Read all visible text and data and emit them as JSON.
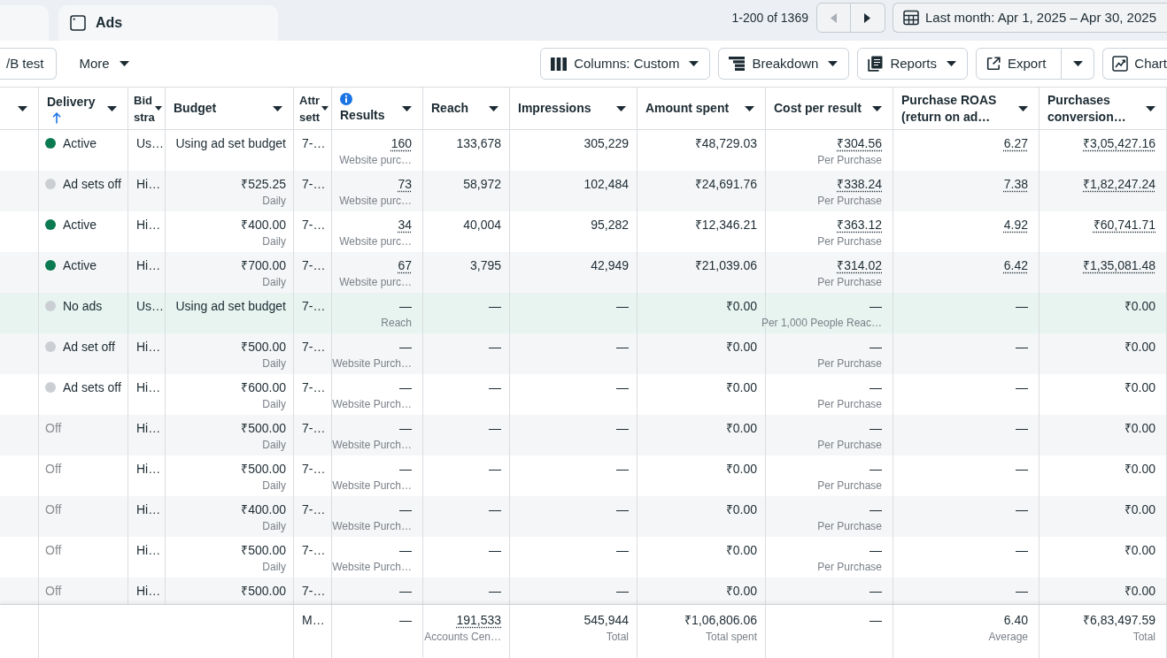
{
  "tabs": [
    {
      "kind": "stub"
    },
    {
      "kind": "tab",
      "label": "Ads"
    }
  ],
  "pagination": {
    "range": "1-200 of 1369",
    "previous": {
      "disabled": true
    },
    "next": {
      "disabled": false
    }
  },
  "date_range": {
    "label": "Last month: Apr 1, 2025 – Apr 30, 2025"
  },
  "toolbar": {
    "left": [
      {
        "kind": "clipped",
        "label": "/B test"
      },
      {
        "kind": "menu",
        "label": "More"
      }
    ],
    "right": [
      {
        "kind": "dropdown",
        "label": "Columns: Custom"
      },
      {
        "kind": "dropdown",
        "label": "Breakdown"
      },
      {
        "kind": "dropdown",
        "label": "Reports"
      },
      {
        "kind": "split",
        "label": "Export"
      },
      {
        "kind": "clipped",
        "label": "Chart"
      }
    ]
  },
  "table": {
    "columns": [
      {
        "sorted": false,
        "info": false
      },
      {
        "label": "Delivery",
        "sorted": true,
        "info": false
      },
      {
        "label": "Bid stra",
        "sorted": false,
        "info": false
      },
      {
        "label": "Budget",
        "sorted": false,
        "info": false
      },
      {
        "label": "Attr sett",
        "sorted": false,
        "info": false
      },
      {
        "label": "Results",
        "sorted": false,
        "info": true
      },
      {
        "label": "Reach",
        "sorted": false,
        "info": false
      },
      {
        "label": "Impressions",
        "sorted": false,
        "info": false
      },
      {
        "label": "Amount spent",
        "sorted": false,
        "info": false
      },
      {
        "label": "Cost per result",
        "sorted": false,
        "info": false
      },
      {
        "label": "Purchase ROAS (return on ad…",
        "sorted": false,
        "info": false
      },
      {
        "label": "Purchases conversion…",
        "sorted": false,
        "info": false
      }
    ],
    "rows": [
      {
        "highlighted": false,
        "cells": [
          "",
          {
            "value": "Active",
            "color": "#0b7a51",
            "muted": false
          },
          {
            "value": "Us…",
            "dotted": false
          },
          {
            "value": "Using ad set budget",
            "dotted": false
          },
          {
            "value": "7-…",
            "dotted": false
          },
          {
            "value": "160",
            "sub": "Website purc…",
            "dotted": true
          },
          {
            "value": "133,678",
            "dotted": false
          },
          {
            "value": "305,229",
            "dotted": false
          },
          {
            "value": "₹48,729.03",
            "dotted": false
          },
          {
            "value": "₹304.56",
            "sub": "Per Purchase",
            "dotted": true
          },
          {
            "value": "6.27",
            "dotted": true
          },
          {
            "value": "₹3,05,427.16",
            "dotted": true
          }
        ]
      },
      {
        "highlighted": false,
        "cells": [
          "",
          {
            "value": "Ad sets off",
            "color": "#cbcfd4",
            "muted": false
          },
          {
            "value": "Hi…",
            "dotted": false
          },
          {
            "value": "₹525.25",
            "sub": "Daily",
            "dotted": false
          },
          {
            "value": "7-…",
            "dotted": false
          },
          {
            "value": "73",
            "sub": "Website purc…",
            "dotted": true
          },
          {
            "value": "58,972",
            "dotted": false
          },
          {
            "value": "102,484",
            "dotted": false
          },
          {
            "value": "₹24,691.76",
            "dotted": false
          },
          {
            "value": "₹338.24",
            "sub": "Per Purchase",
            "dotted": true
          },
          {
            "value": "7.38",
            "dotted": true
          },
          {
            "value": "₹1,82,247.24",
            "dotted": true
          }
        ]
      },
      {
        "highlighted": false,
        "cells": [
          "",
          {
            "value": "Active",
            "color": "#0b7a51",
            "muted": false
          },
          {
            "value": "Hi…",
            "dotted": false
          },
          {
            "value": "₹400.00",
            "sub": "Daily",
            "dotted": false
          },
          {
            "value": "7-…",
            "dotted": false
          },
          {
            "value": "34",
            "sub": "Website purc…",
            "dotted": true
          },
          {
            "value": "40,004",
            "dotted": false
          },
          {
            "value": "95,282",
            "dotted": false
          },
          {
            "value": "₹12,346.21",
            "dotted": false
          },
          {
            "value": "₹363.12",
            "sub": "Per Purchase",
            "dotted": true
          },
          {
            "value": "4.92",
            "dotted": true
          },
          {
            "value": "₹60,741.71",
            "dotted": true
          }
        ]
      },
      {
        "highlighted": false,
        "cells": [
          "",
          {
            "value": "Active",
            "color": "#0b7a51",
            "muted": false
          },
          {
            "value": "Hi…",
            "dotted": false
          },
          {
            "value": "₹700.00",
            "sub": "Daily",
            "dotted": false
          },
          {
            "value": "7-…",
            "dotted": false
          },
          {
            "value": "67",
            "sub": "Website purc…",
            "dotted": true
          },
          {
            "value": "3,795",
            "dotted": false
          },
          {
            "value": "42,949",
            "dotted": false
          },
          {
            "value": "₹21,039.06",
            "dotted": false
          },
          {
            "value": "₹314.02",
            "sub": "Per Purchase",
            "dotted": true
          },
          {
            "value": "6.42",
            "dotted": true
          },
          {
            "value": "₹1,35,081.48",
            "dotted": true
          }
        ]
      },
      {
        "highlighted": true,
        "cells": [
          "",
          {
            "value": "No ads",
            "color": "#cbcfd4",
            "muted": false
          },
          {
            "value": "Us…",
            "dotted": false
          },
          {
            "value": "Using ad set budget",
            "dotted": false
          },
          {
            "value": "7-…",
            "dotted": false
          },
          {
            "value": "—",
            "sub": "Reach",
            "dotted": false
          },
          {
            "value": "—",
            "dotted": false
          },
          {
            "value": "—",
            "dotted": false
          },
          {
            "value": "₹0.00",
            "dotted": false
          },
          {
            "value": "—",
            "sub": "Per 1,000 People Reac…",
            "dotted": false
          },
          {
            "value": "—",
            "dotted": false
          },
          {
            "value": "₹0.00",
            "dotted": false
          }
        ]
      },
      {
        "highlighted": false,
        "cells": [
          "",
          {
            "value": "Ad set off",
            "color": "#cbcfd4",
            "muted": false
          },
          {
            "value": "Hi…",
            "dotted": false
          },
          {
            "value": "₹500.00",
            "sub": "Daily",
            "dotted": false
          },
          {
            "value": "7-…",
            "dotted": false
          },
          {
            "value": "—",
            "sub": "Website Purch…",
            "dotted": false
          },
          {
            "value": "—",
            "dotted": false
          },
          {
            "value": "—",
            "dotted": false
          },
          {
            "value": "₹0.00",
            "dotted": false
          },
          {
            "value": "—",
            "sub": "Per Purchase",
            "dotted": false
          },
          {
            "value": "—",
            "dotted": false
          },
          {
            "value": "₹0.00",
            "dotted": false
          }
        ]
      },
      {
        "highlighted": false,
        "cells": [
          "",
          {
            "value": "Ad sets off",
            "color": "#cbcfd4",
            "muted": false
          },
          {
            "value": "Hi…",
            "dotted": false
          },
          {
            "value": "₹600.00",
            "sub": "Daily",
            "dotted": false
          },
          {
            "value": "7-…",
            "dotted": false
          },
          {
            "value": "—",
            "sub": "Website Purch…",
            "dotted": false
          },
          {
            "value": "—",
            "dotted": false
          },
          {
            "value": "—",
            "dotted": false
          },
          {
            "value": "₹0.00",
            "dotted": false
          },
          {
            "value": "—",
            "sub": "Per Purchase",
            "dotted": false
          },
          {
            "value": "—",
            "dotted": false
          },
          {
            "value": "₹0.00",
            "dotted": false
          }
        ]
      },
      {
        "highlighted": false,
        "cells": [
          "",
          {
            "value": "Off",
            "muted": true
          },
          {
            "value": "Hi…",
            "dotted": false
          },
          {
            "value": "₹500.00",
            "sub": "Daily",
            "dotted": false
          },
          {
            "value": "7-…",
            "dotted": false
          },
          {
            "value": "—",
            "sub": "Website Purch…",
            "dotted": false
          },
          {
            "value": "—",
            "dotted": false
          },
          {
            "value": "—",
            "dotted": false
          },
          {
            "value": "₹0.00",
            "dotted": false
          },
          {
            "value": "—",
            "sub": "Per Purchase",
            "dotted": false
          },
          {
            "value": "—",
            "dotted": false
          },
          {
            "value": "₹0.00",
            "dotted": false
          }
        ]
      },
      {
        "highlighted": false,
        "cells": [
          "",
          {
            "value": "Off",
            "muted": true
          },
          {
            "value": "Hi…",
            "dotted": false
          },
          {
            "value": "₹500.00",
            "sub": "Daily",
            "dotted": false
          },
          {
            "value": "7-…",
            "dotted": false
          },
          {
            "value": "—",
            "sub": "Website Purch…",
            "dotted": false
          },
          {
            "value": "—",
            "dotted": false
          },
          {
            "value": "—",
            "dotted": false
          },
          {
            "value": "₹0.00",
            "dotted": false
          },
          {
            "value": "—",
            "sub": "Per Purchase",
            "dotted": false
          },
          {
            "value": "—",
            "dotted": false
          },
          {
            "value": "₹0.00",
            "dotted": false
          }
        ]
      },
      {
        "highlighted": false,
        "cells": [
          "",
          {
            "value": "Off",
            "muted": true
          },
          {
            "value": "Hi…",
            "dotted": false
          },
          {
            "value": "₹400.00",
            "sub": "Daily",
            "dotted": false
          },
          {
            "value": "7-…",
            "dotted": false
          },
          {
            "value": "—",
            "sub": "Website Purch…",
            "dotted": false
          },
          {
            "value": "—",
            "dotted": false
          },
          {
            "value": "—",
            "dotted": false
          },
          {
            "value": "₹0.00",
            "dotted": false
          },
          {
            "value": "—",
            "sub": "Per Purchase",
            "dotted": false
          },
          {
            "value": "—",
            "dotted": false
          },
          {
            "value": "₹0.00",
            "dotted": false
          }
        ]
      },
      {
        "highlighted": false,
        "cells": [
          "",
          {
            "value": "Off",
            "muted": true
          },
          {
            "value": "Hi…",
            "dotted": false
          },
          {
            "value": "₹500.00",
            "sub": "Daily",
            "dotted": false
          },
          {
            "value": "7-…",
            "dotted": false
          },
          {
            "value": "—",
            "sub": "Website Purch…",
            "dotted": false
          },
          {
            "value": "—",
            "dotted": false
          },
          {
            "value": "—",
            "dotted": false
          },
          {
            "value": "₹0.00",
            "dotted": false
          },
          {
            "value": "—",
            "sub": "Per Purchase",
            "dotted": false
          },
          {
            "value": "—",
            "dotted": false
          },
          {
            "value": "₹0.00",
            "dotted": false
          }
        ]
      },
      {
        "highlighted": false,
        "cells": [
          "",
          {
            "value": "Off",
            "muted": true
          },
          {
            "value": "Hi…",
            "dotted": false
          },
          {
            "value": "₹500.00",
            "dotted": false
          },
          {
            "value": "7-…",
            "dotted": false
          },
          {
            "value": "—",
            "dotted": false
          },
          {
            "value": "—",
            "dotted": false
          },
          {
            "value": "—",
            "dotted": false
          },
          {
            "value": "₹0.00",
            "dotted": false
          },
          {
            "value": "—",
            "dotted": false
          },
          {
            "value": "—",
            "dotted": false
          },
          {
            "value": "₹0.00",
            "dotted": false
          }
        ]
      }
    ],
    "totals": [
      {
        "value": "M…",
        "dotted": false
      },
      {
        "value": "—",
        "dotted": false
      },
      {
        "value": "191,533",
        "sub": "Accounts Cen…",
        "dotted": true
      },
      {
        "value": "545,944",
        "sub": "Total",
        "dotted": false
      },
      {
        "value": "₹1,06,806.06",
        "sub": "Total spent",
        "dotted": false
      },
      {
        "value": "—",
        "dotted": false
      },
      {
        "value": "6.40",
        "sub": "Average",
        "dotted": false
      },
      {
        "value": "₹6,83,497.59",
        "sub": "Total",
        "dotted": false
      }
    ]
  }
}
